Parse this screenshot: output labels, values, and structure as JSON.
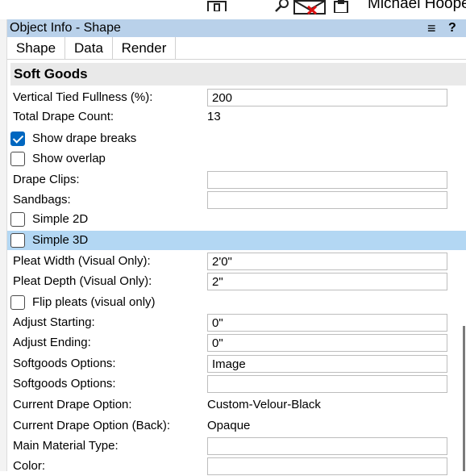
{
  "topbar": {
    "user_name": "Michael Hoope"
  },
  "panel": {
    "title": "Object Info - Shape",
    "menu_icon": "≡",
    "help_icon": "?"
  },
  "tabs": [
    {
      "label": "Shape"
    },
    {
      "label": "Data"
    },
    {
      "label": "Render"
    }
  ],
  "section": {
    "title": "Soft Goods"
  },
  "fields": {
    "vertical_tied_fullness": {
      "label": "Vertical Tied Fullness (%):",
      "value": "200"
    },
    "total_drape_count": {
      "label": "Total Drape Count:",
      "value": "13"
    },
    "show_drape_breaks": {
      "label": "Show drape breaks",
      "checked": true
    },
    "show_overlap": {
      "label": "Show overlap",
      "checked": false
    },
    "drape_clips": {
      "label": "Drape Clips:",
      "value": ""
    },
    "sandbags": {
      "label": "Sandbags:",
      "value": ""
    },
    "simple_2d": {
      "label": "Simple 2D",
      "checked": false
    },
    "simple_3d": {
      "label": "Simple 3D",
      "checked": false,
      "highlighted": true
    },
    "pleat_width": {
      "label": "Pleat Width (Visual Only):",
      "value": "2'0\""
    },
    "pleat_depth": {
      "label": "Pleat Depth (Visual Only):",
      "value": "2\""
    },
    "flip_pleats": {
      "label": "Flip pleats (visual only)",
      "checked": false
    },
    "adjust_starting": {
      "label": "Adjust Starting:",
      "value": "0\""
    },
    "adjust_ending": {
      "label": "Adjust Ending:",
      "value": "0\""
    },
    "softgoods_options_1": {
      "label": "Softgoods Options:",
      "value": "Image"
    },
    "softgoods_options_2": {
      "label": "Softgoods Options:",
      "value": ""
    },
    "current_drape_option": {
      "label": "Current Drape Option:",
      "value": "Custom-Velour-Black"
    },
    "current_drape_option_back": {
      "label": "Current Drape Option (Back):",
      "value": "Opaque"
    },
    "main_material_type": {
      "label": "Main Material Type:",
      "value": ""
    },
    "color": {
      "label": "Color:",
      "value": ""
    }
  },
  "colors": {
    "title_bar": "#b9d1ea",
    "highlight_row": "#b3d7f3",
    "checkbox_accent": "#0067c0",
    "section_header": "#e9e9e9"
  }
}
